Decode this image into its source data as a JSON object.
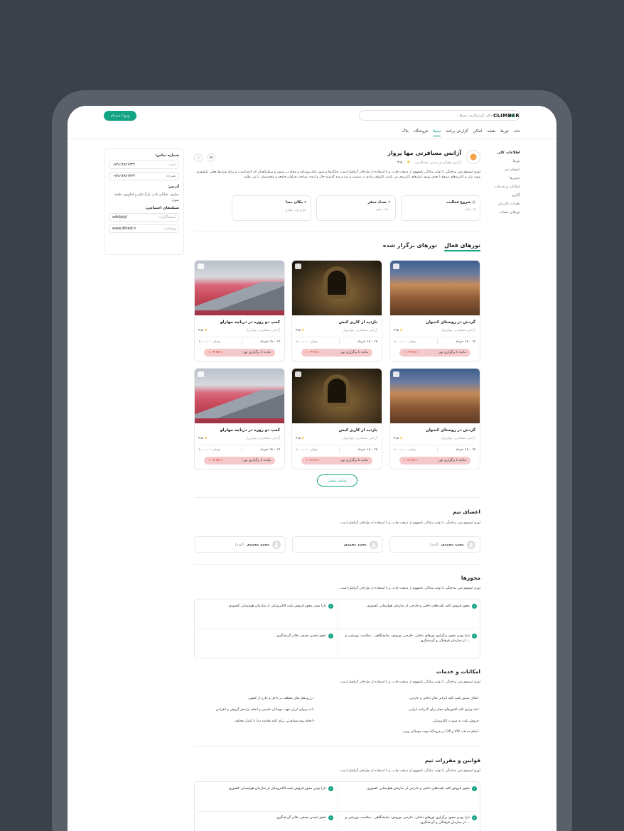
{
  "header": {
    "logo": "CLIMBER",
    "search_placeholder": "جستجوی اماکن گردشگری، تورها...",
    "login": "ورود/ ثبت‌نام"
  },
  "nav": [
    "خانه",
    "تورها",
    "نقشه",
    "اماکن",
    "گزارش برنامه",
    "تیم‌ها",
    "فروشگاه",
    "بلاگ"
  ],
  "sidebar": {
    "title": "اطلاعات کلی",
    "items": [
      "تورها",
      "اعضای تیم",
      "مجوزها",
      "امکانات و خدمات",
      "گالری",
      "نظرات کاربران",
      "تورهای مشابه"
    ]
  },
  "contact": {
    "title": "شماره تماس:",
    "phone_label": "ثابت:",
    "phone": "۰۹۳۸۱۳۸۴۶۳۳۴",
    "mobile_label": "همراه:",
    "mobile": "۰۹۳۸۱۳۸۴۶۳۳۴",
    "addr_title": "آدرس:",
    "address": "ساری، خیابان نادر، پارک‌علم و فناوری، طبقه سوم",
    "social_title": "شبکه‌های اجتماعی:",
    "insta_label": "اینستاگرام:",
    "insta": "sdkfjskjf",
    "web_label": "وبسایت:",
    "web": "www.dfhksf.ir"
  },
  "agency": {
    "name": "آژانس مسافرتی مها پرواز",
    "type": "آژانس هوایی و زمینی مسافرتی",
    "rating": "۳.۵",
    "desc": "لورم ایپسوم متن ساختگی با تولید سادگی نامفهوم از صنعت چاپ، و با استفاده از طراحان گرافیک است، چاپگرها و متون بلکه روزنامه و مجله در ستون و سطرآنچنان که لازم است، و برای شرایط فعلی تکنولوژی مورد نیاز، و کاربردهای متنوع با هدف بهبود ابزارهای کاربردی می باشد، کتابهای زیادی در شصت و سه درصد گذشته حال و آینده، شناخت فراوان جامعه و متخصصان را می طلبد."
  },
  "stats": [
    {
      "title": "شروع فعالیت",
      "value": "۱۵ سال"
    },
    {
      "title": "تعداد سفر",
      "value": "۵۰۰+ سفر"
    },
    {
      "title": "مکان مبدا",
      "value": "مازندران، ساری"
    }
  ],
  "tabs": {
    "active": "تورهای فعال",
    "other": "تورهای برگزار شده"
  },
  "cards": [
    {
      "title": "گردش در روستای کندوان",
      "agency": "آژانس مسافرتی مهاپرواز",
      "rating": "۳.۵",
      "date": "۱۷ - ۱۸ خرداد",
      "price": "۱,۰۰۰,۰۰۰",
      "unit": "تومان",
      "cd_label": "مانده تا برگزاری تور:",
      "cd": "۱۰:۳:۲۵:۱۰",
      "img": "a"
    },
    {
      "title": "بازدید از کاریز کیش",
      "agency": "آژانس مسافرتی مهاپرواز",
      "rating": "۳.۵",
      "date": "۱۷ - ۱۸ خرداد",
      "price": "۱,۰۰۰,۰۰۰",
      "unit": "تومان",
      "cd_label": "مانده تا برگزاری تور:",
      "cd": "۱۰:۳:۲۵:۱۰",
      "img": "b"
    },
    {
      "title": "کمپ دو روزه در دریاچه مهارلو",
      "agency": "آژانس مسافرتی مهاپرواز",
      "rating": "۳.۵",
      "date": "۱۷ - ۱۸ خرداد",
      "price": "۱,۰۰۰,۰۰۰",
      "unit": "تومان",
      "cd_label": "مانده تا برگزاری تور:",
      "cd": "۱۰:۳:۲۵:۱۰",
      "img": "c"
    },
    {
      "title": "گردش در روستای کندوان",
      "agency": "آژانس مسافرتی مهاپرواز",
      "rating": "۳.۵",
      "date": "۱۷ - ۱۸ خرداد",
      "price": "۱,۰۰۰,۰۰۰",
      "unit": "تومان",
      "cd_label": "مانده تا برگزاری تور:",
      "cd": "۱۰:۳:۲۵:۱۰",
      "img": "a"
    },
    {
      "title": "بازدید از کاریز کیش",
      "agency": "آژانس مسافرتی مهاپرواز",
      "rating": "۳.۵",
      "date": "۱۷ - ۱۸ خرداد",
      "price": "۱,۰۰۰,۰۰۰",
      "unit": "تومان",
      "cd_label": "مانده تا برگزاری تور:",
      "cd": "۱۰:۳:۲۵:۱۰",
      "img": "b"
    },
    {
      "title": "کمپ دو روزه در دریاچه مهارلو",
      "agency": "آژانس مسافرتی مهاپرواز",
      "rating": "۳.۵",
      "date": "۱۷ - ۱۸ خرداد",
      "price": "۱,۰۰۰,۰۰۰",
      "unit": "تومان",
      "cd_label": "مانده تا برگزاری تور:",
      "cd": "۱۰:۳:۲۵:۱۰",
      "img": "c"
    }
  ],
  "more": "نمایش بیشتر",
  "team": {
    "title": "اعضای تیم",
    "desc": "لورم ایپسوم متن ساختگی با تولید سادگی نامفهوم از صنعت چاپ، و با استفاده از طراحان گرافیک است.",
    "members": [
      {
        "name": "محمد محمدی",
        "role": "(لیدر)"
      },
      {
        "name": "محمد محمدی",
        "role": ""
      },
      {
        "name": "محمد محمدی",
        "role": "(لیدر)"
      }
    ]
  },
  "licenses": {
    "title": "مجوزها",
    "desc": "لورم ایپسوم متن ساختگی با تولید سادگی نامفهوم از صنعت چاپ، و با استفاده از طراحان گرافیک است.",
    "items": [
      "مجوز فروش کلیه بلیت‌های داخلی و خارجی از سازمان هواپیمایی کشوری.",
      "دارا بودن مجوز فروش بلیت الکترونیکی از سازمان هواپیمایی کشوری.",
      "دارا بودن مجوز برگزاری تورهای داخلی، خارجی، ورودی، نمایشگاهی ، سلامت، ورزشی و ... از سازمان فرهنگی و گردشگری.",
      "عضو انجمن صنفی دفاتر گردشگری."
    ]
  },
  "services": {
    "title": "امکانات و خدمات",
    "desc": "لورم ایپسوم متن ساختگی با تولید سادگی نامفهوم از صنعت چاپ، و با استفاده از طراحان گرافیک است.",
    "items": [
      "- امکان صدور بلیت کلیه ایرلاین های داخلی و خارجی.",
      "- رزرو هتل های مختلف در داخل و خارج از کشور.",
      "- اخذ ویزای کلیه کشورهای مجاز برای گذرنامه ایرانی.",
      "- اخذ ویزای ایران جهت مهمانان خارجی و انجام تراسفر گروهی و انفرادی",
      "- فروش بلیت به صورت الکترونیکی.",
      "- انجام بیمه مسافرتی برای کلیه مقاصد دنیا با اعتبار مختلف.",
      "- انجام خدمات VIP و CIP در فرودگاه جهت مهمانان ویژه."
    ]
  },
  "rules": {
    "title": "قوانین و مقررات تیم",
    "desc": "لورم ایپسوم متن ساختگی با تولید سادگی نامفهوم از صنعت چاپ، و با استفاده از طراحان گرافیک است.",
    "items": [
      "مجوز فروش کلیه بلیت‌های داخلی و خارجی از سازمان هواپیمایی کشوری.",
      "دارا بودن مجوز فروش بلیت الکترونیکی از سازمان هواپیمایی کشوری.",
      "دارا بودن مجوز برگزاری تورهای داخلی، خارجی، ورودی، نمایشگاهی ، سلامت، ورزشی و ... از سازمان فرهنگی و گردشگری.",
      "عضو انجمن صنفی دفاتر گردشگری."
    ]
  },
  "colors": {
    "accent": "#13a385",
    "countdown_bg": "#f5c9c9",
    "countdown_text": "#d0303a",
    "rating": "#f4b400"
  }
}
